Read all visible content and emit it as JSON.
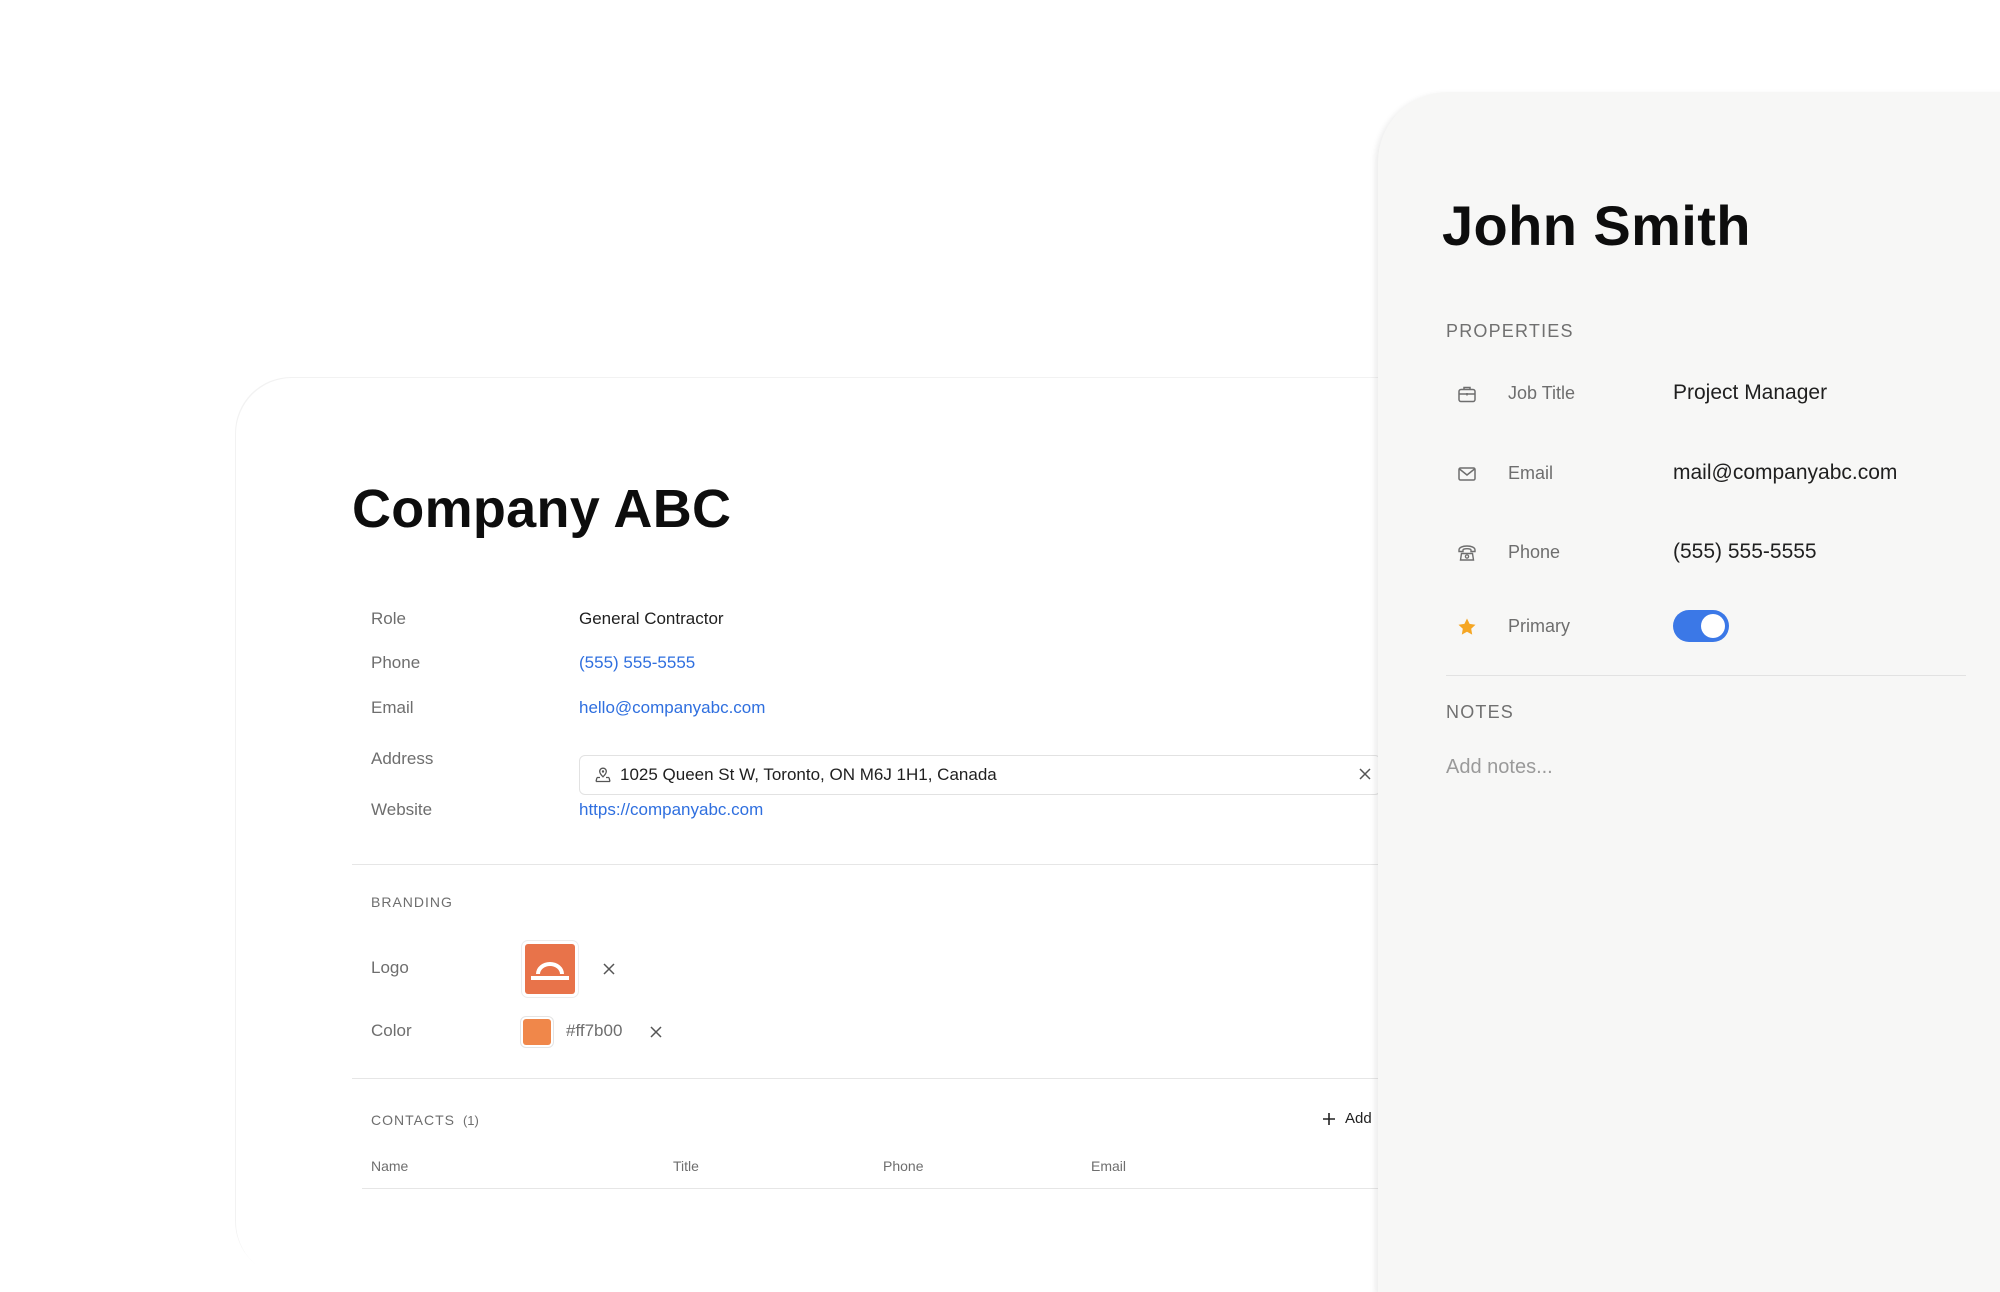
{
  "company": {
    "name": "Company ABC",
    "fields": {
      "role": {
        "label": "Role",
        "value": "General Contractor"
      },
      "phone": {
        "label": "Phone",
        "value": "(555) 555-5555"
      },
      "email": {
        "label": "Email",
        "value": "hello@companyabc.com"
      },
      "address": {
        "label": "Address",
        "value": "1025 Queen St W, Toronto, ON M6J 1H1, Canada"
      },
      "website": {
        "label": "Website",
        "value": "https://companyabc.com"
      }
    },
    "branding": {
      "title": "BRANDING",
      "logo_label": "Logo",
      "color_label": "Color",
      "color_hex": "#ff7b00",
      "logo_bg_color": "#e8734a"
    },
    "contacts": {
      "title": "CONTACTS",
      "count": "(1)",
      "add_label": "Add",
      "columns": [
        "Name",
        "Title",
        "Phone",
        "Email"
      ]
    },
    "icons": {
      "address": "map-pin-icon",
      "clear": "close-icon",
      "add": "plus-icon"
    }
  },
  "contact_panel": {
    "name": "John Smith",
    "properties_title": "PROPERTIES",
    "properties": {
      "job_title": {
        "label": "Job Title",
        "value": "Project Manager",
        "icon": "briefcase-icon"
      },
      "email": {
        "label": "Email",
        "value": "mail@companyabc.com",
        "icon": "mail-icon"
      },
      "phone": {
        "label": "Phone",
        "value": "(555) 555-5555",
        "icon": "phone-icon"
      },
      "primary": {
        "label": "Primary",
        "icon": "star-icon",
        "enabled": true
      }
    },
    "notes_title": "NOTES",
    "notes_placeholder": "Add notes..."
  },
  "colors": {
    "link": "#2f6fdf",
    "toggle_on": "#3b78e7",
    "star": "#f5a623",
    "panel_bg": "#f7f7f6"
  }
}
